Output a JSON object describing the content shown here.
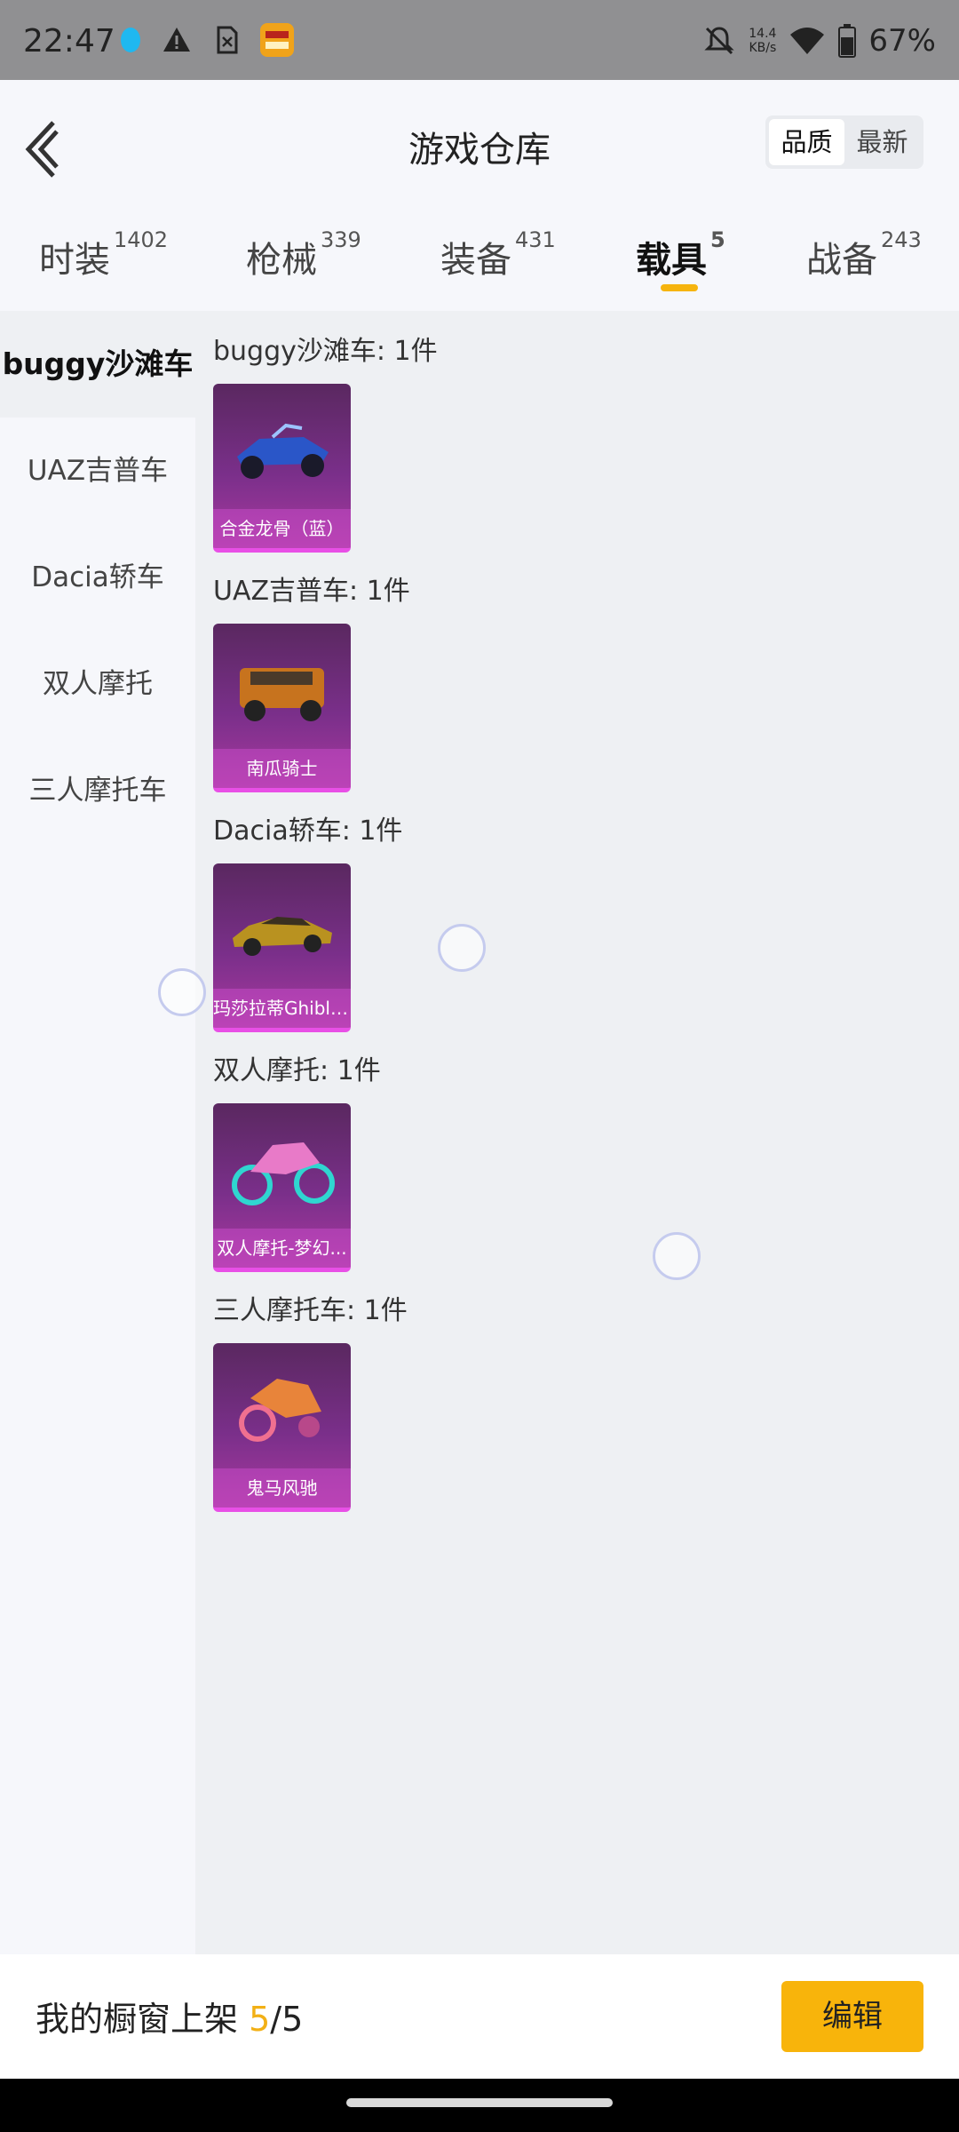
{
  "status_bar": {
    "time": "22:47",
    "net_speed_value": "14.4",
    "net_speed_unit": "KB/s",
    "battery": "67%",
    "icons": [
      "qq-icon",
      "warning-icon",
      "sim-off-icon",
      "app-icon",
      "mute-bell-icon",
      "wifi-icon",
      "battery-icon"
    ]
  },
  "header": {
    "title": "游戏仓库",
    "sort_quality": "品质",
    "sort_newest": "最新"
  },
  "tabs": [
    {
      "label": "时装",
      "count": "1402"
    },
    {
      "label": "枪械",
      "count": "339"
    },
    {
      "label": "装备",
      "count": "431"
    },
    {
      "label": "载具",
      "count": "5"
    },
    {
      "label": "战备",
      "count": "243"
    }
  ],
  "sidebar": {
    "items": [
      {
        "label": "buggy沙滩车"
      },
      {
        "label": "UAZ吉普车"
      },
      {
        "label": "Dacia轿车"
      },
      {
        "label": "双人摩托"
      },
      {
        "label": "三人摩托车"
      }
    ]
  },
  "groups": [
    {
      "title": "buggy沙滩车: 1件",
      "item_name": "合金龙骨（蓝）"
    },
    {
      "title": "UAZ吉普车: 1件",
      "item_name": "南瓜骑士"
    },
    {
      "title": "Dacia轿车: 1件",
      "item_name": "玛莎拉蒂Ghibli(..."
    },
    {
      "title": "双人摩托: 1件",
      "item_name": "双人摩托-梦幻..."
    },
    {
      "title": "三人摩托车: 1件",
      "item_name": "鬼马风驰"
    }
  ],
  "footer": {
    "label": "我的橱窗上架",
    "shown": "5",
    "separator": "/",
    "total": "5",
    "edit_button": "编辑"
  },
  "colors": {
    "accent": "#f8b40b",
    "card_bg": "#7a2f8a",
    "card_border": "#e84fe6"
  }
}
